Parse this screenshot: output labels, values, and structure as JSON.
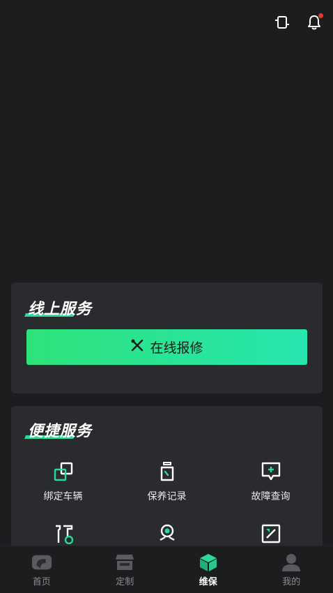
{
  "topbar": {
    "icons": [
      "device-icon",
      "bell-icon"
    ],
    "has_notification": true
  },
  "online_service": {
    "title": "线上服务",
    "repair_button": "在线报修",
    "accent": "#2bd99a"
  },
  "quick_service": {
    "title": "便捷服务",
    "items": [
      {
        "label": "绑定车辆",
        "icon": "link-icon"
      },
      {
        "label": "保养记录",
        "icon": "oil-bottle-icon"
      },
      {
        "label": "故障查询",
        "icon": "chat-plus-icon"
      },
      {
        "label": "",
        "icon": "tools-icon"
      },
      {
        "label": "",
        "icon": "location-pin-icon"
      },
      {
        "label": "",
        "icon": "discount-icon"
      }
    ]
  },
  "tabbar": {
    "tabs": [
      {
        "label": "首页",
        "icon": "home-icon",
        "active": false
      },
      {
        "label": "定制",
        "icon": "store-icon",
        "active": false
      },
      {
        "label": "维保",
        "icon": "cube-icon",
        "active": true
      },
      {
        "label": "我的",
        "icon": "user-icon",
        "active": false
      }
    ]
  },
  "colors": {
    "background": "#1c1d1f",
    "card": "#2a2b2f",
    "accent_green": "#2bd99a",
    "badge_red": "#e33333"
  }
}
